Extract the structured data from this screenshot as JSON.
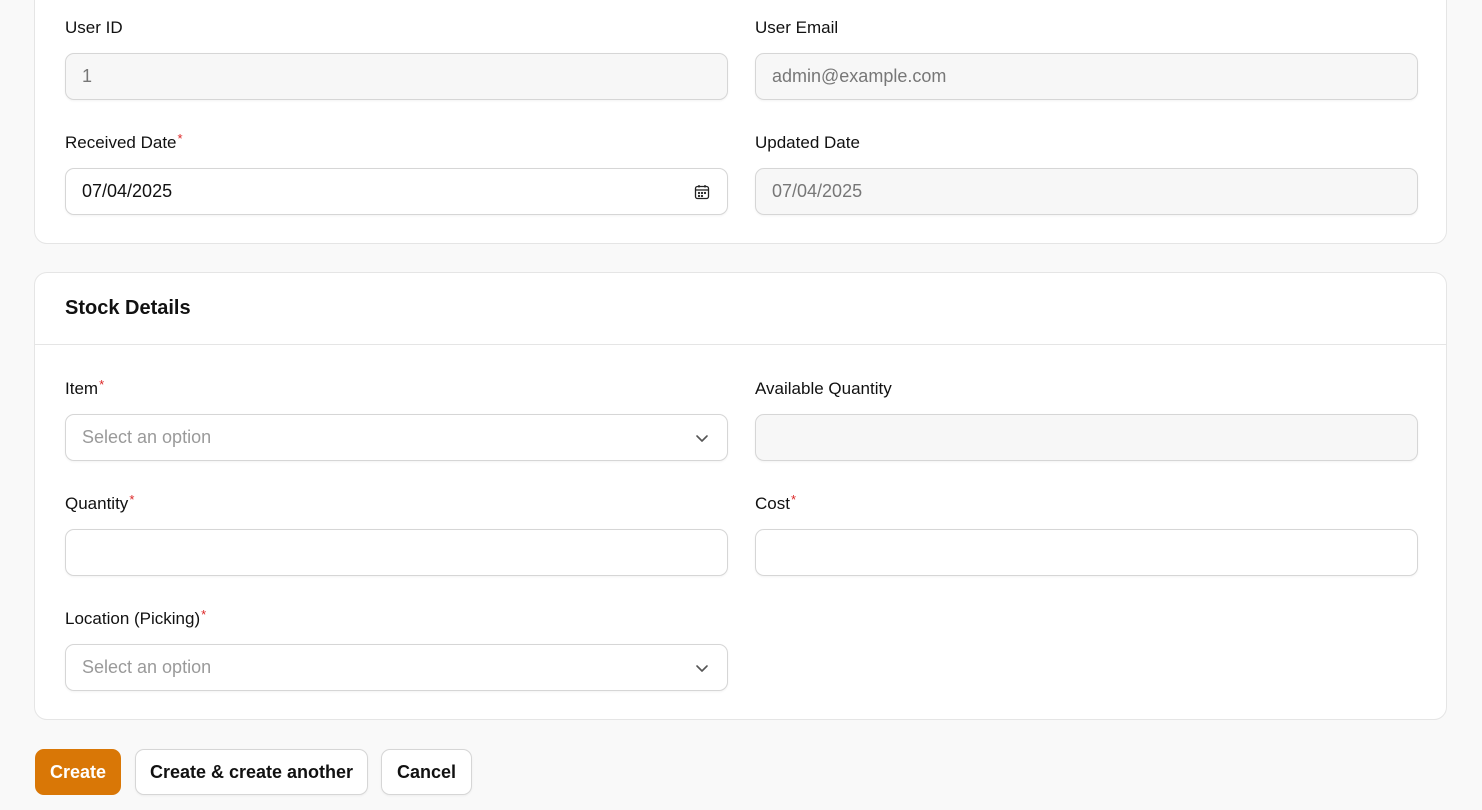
{
  "general": {
    "user_id": {
      "label": "User ID",
      "value": "1"
    },
    "user_email": {
      "label": "User Email",
      "value": "admin@example.com"
    },
    "received_date": {
      "label": "Received Date",
      "required": "*",
      "value": "07/04/2025",
      "icon": "calendar-icon"
    },
    "updated_date": {
      "label": "Updated Date",
      "value": "07/04/2025"
    }
  },
  "stock": {
    "title": "Stock Details",
    "item": {
      "label": "Item",
      "required": "*",
      "placeholder": "Select an option",
      "icon": "chevron-down-icon"
    },
    "available_quantity": {
      "label": "Available Quantity",
      "value": ""
    },
    "quantity": {
      "label": "Quantity",
      "required": "*",
      "value": ""
    },
    "cost": {
      "label": "Cost",
      "required": "*",
      "value": ""
    },
    "location": {
      "label": "Location (Picking)",
      "required": "*",
      "placeholder": "Select an option",
      "icon": "chevron-down-icon"
    }
  },
  "actions": {
    "create": "Create",
    "create_another": "Create & create another",
    "cancel": "Cancel"
  },
  "colors": {
    "primary": "#d97706",
    "required": "#dc2626"
  }
}
